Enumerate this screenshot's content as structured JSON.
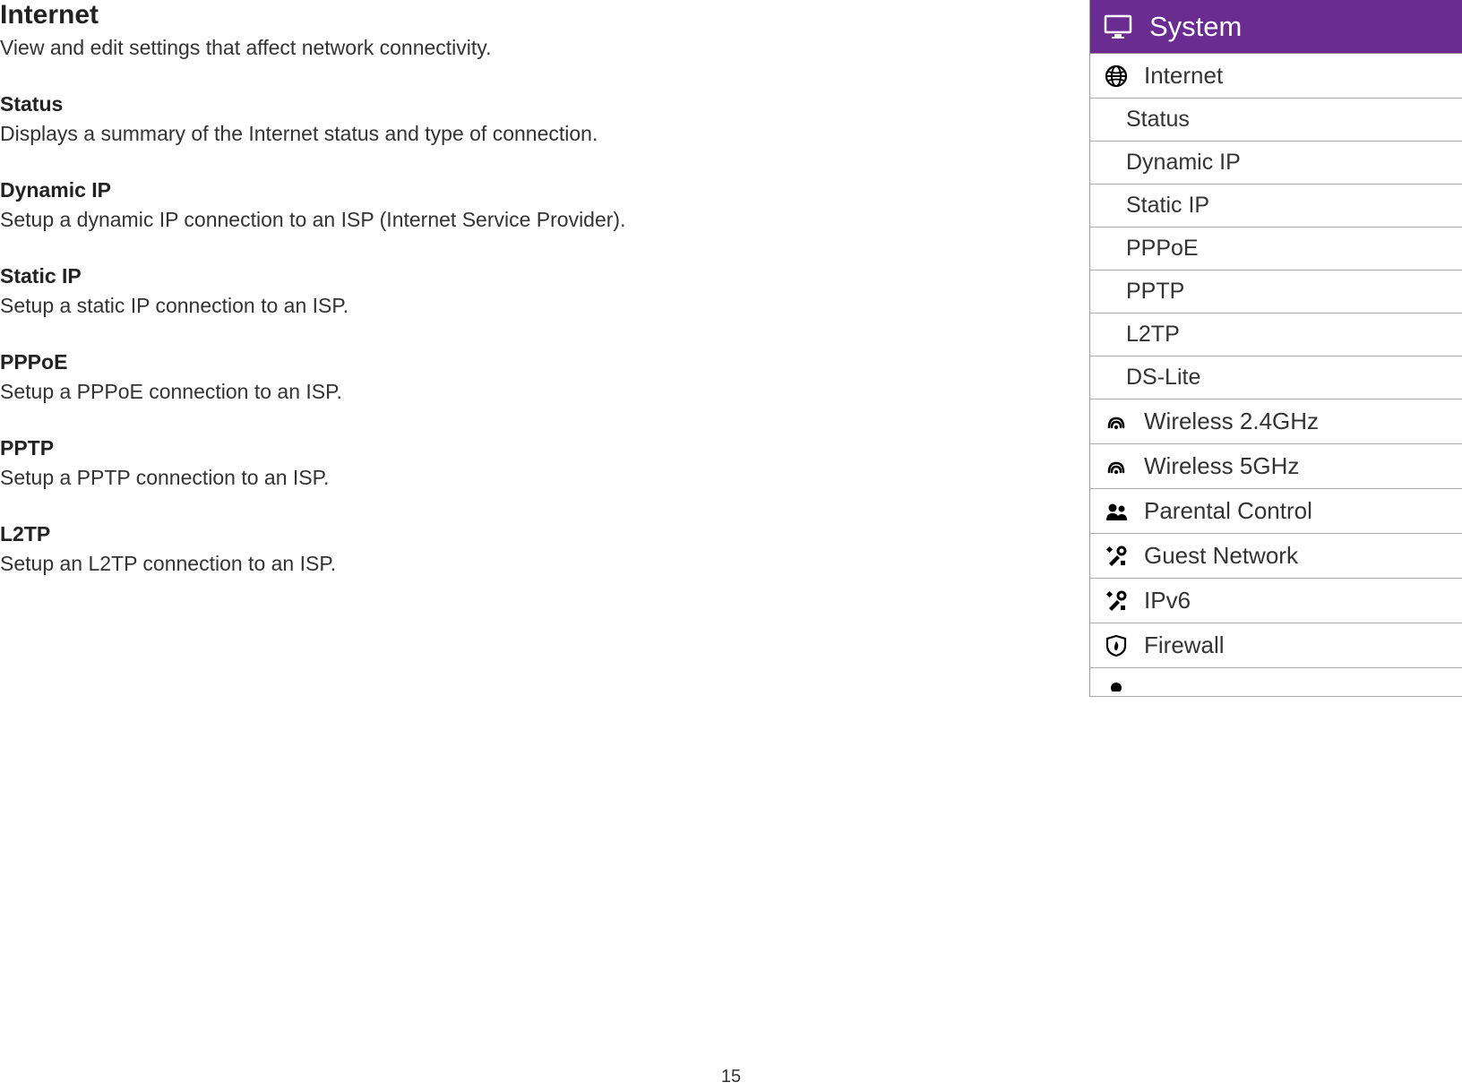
{
  "page": {
    "title": "Internet",
    "subtitle": "View and edit settings that affect network connectivity.",
    "number": "15"
  },
  "sections": {
    "status": {
      "title": "Status",
      "desc": "Displays a summary of the Internet status and type of connection."
    },
    "dynamic_ip": {
      "title": "Dynamic IP",
      "desc": "Setup a dynamic IP connection to an ISP (Internet Service Provider)."
    },
    "static_ip": {
      "title": "Static IP",
      "desc": "Setup a static IP connection to an ISP."
    },
    "pppoe": {
      "title": "PPPoE",
      "desc": "Setup a PPPoE connection to an ISP."
    },
    "pptp": {
      "title": "PPTP",
      "desc": "Setup a PPTP connection to an ISP."
    },
    "l2tp": {
      "title": "L2TP",
      "desc": "Setup an L2TP connection to an ISP."
    }
  },
  "sidebar": {
    "header": "System",
    "internet": {
      "label": "Internet"
    },
    "sub": {
      "status": "Status",
      "dynamic_ip": "Dynamic IP",
      "static_ip": "Static IP",
      "pppoe": "PPPoE",
      "pptp": "PPTP",
      "l2tp": "L2TP",
      "ds_lite": "DS-Lite"
    },
    "items": {
      "wireless24": "Wireless 2.4GHz",
      "wireless5": "Wireless 5GHz",
      "parental": "Parental Control",
      "guest": "Guest Network",
      "ipv6": "IPv6",
      "firewall": "Firewall"
    }
  }
}
